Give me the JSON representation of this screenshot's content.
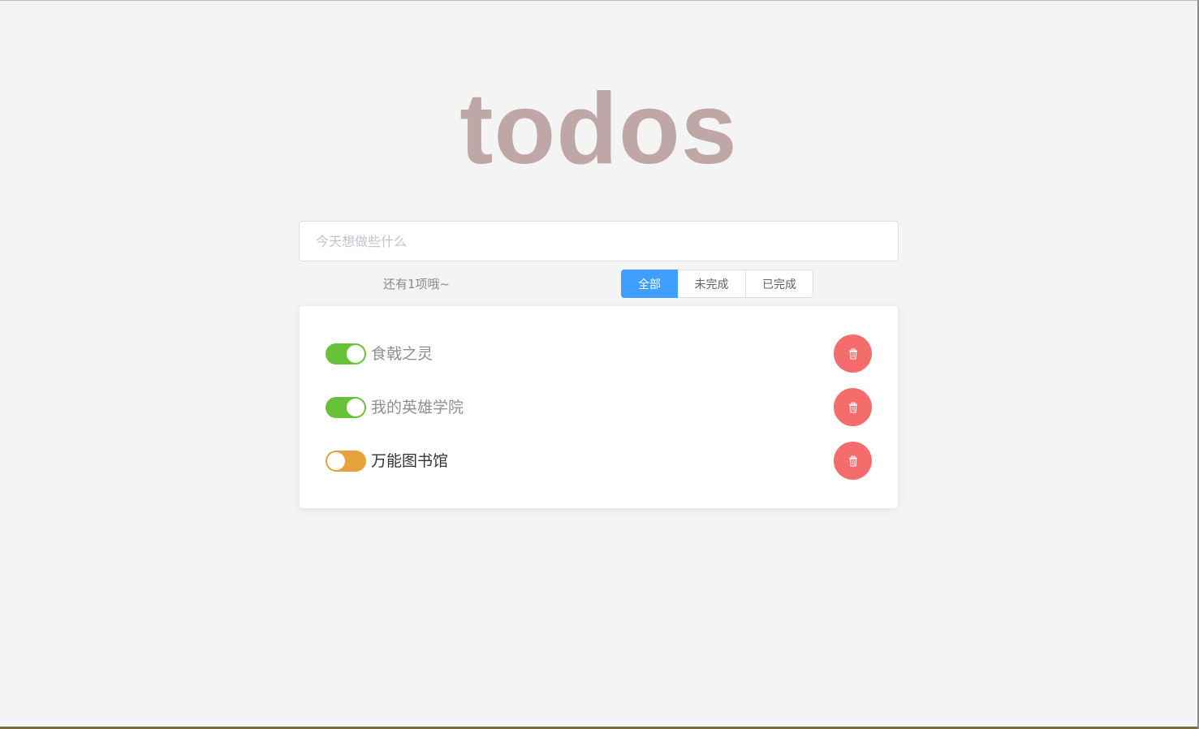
{
  "app": {
    "title": "todos"
  },
  "input": {
    "placeholder": "今天想做些什么",
    "value": ""
  },
  "status": {
    "remaining_text": "还有1项哦~"
  },
  "filters": {
    "items": [
      {
        "label": "全部",
        "active": true
      },
      {
        "label": "未完成",
        "active": false
      },
      {
        "label": "已完成",
        "active": false
      }
    ]
  },
  "todos": [
    {
      "text": "食戟之灵",
      "completed": true
    },
    {
      "text": "我的英雄学院",
      "completed": true
    },
    {
      "text": "万能图书馆",
      "completed": false
    }
  ],
  "icons": {
    "delete": "trash-icon"
  },
  "colors": {
    "title": "#c0a7a7",
    "primary": "#409eff",
    "toggle_on": "#67c23a",
    "toggle_off": "#e6a23c",
    "danger": "#f56c6c"
  }
}
